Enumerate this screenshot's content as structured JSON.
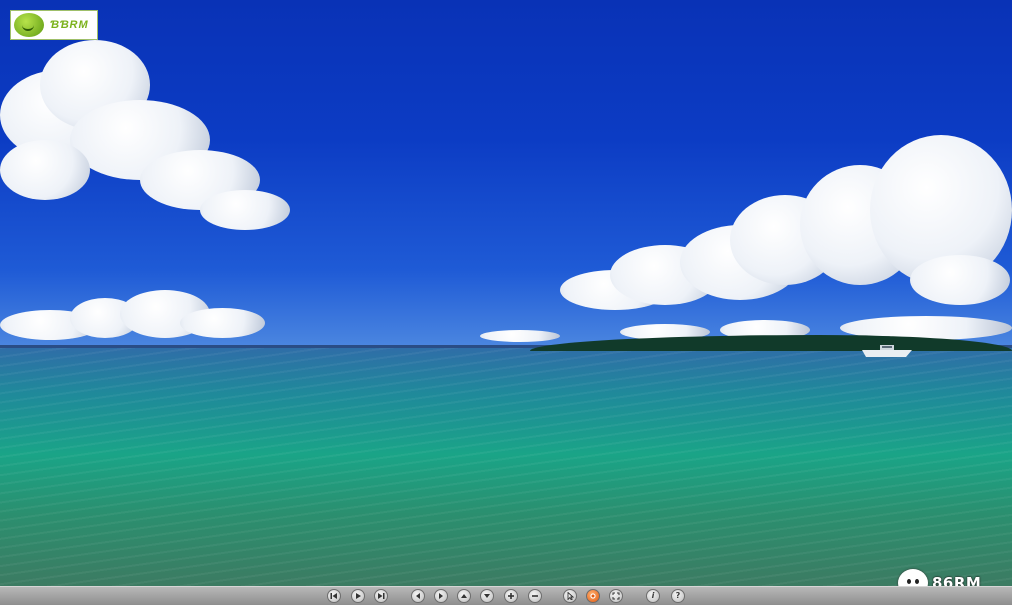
{
  "logo": {
    "text": "ƁƁRM",
    "icon": "smiley-ball-icon",
    "accent": "#7bb21c"
  },
  "brand": {
    "text": "86RM",
    "icon": "face-icon"
  },
  "toolbar": {
    "buttons": [
      {
        "name": "skip-back-button",
        "icon": "skip-back-icon"
      },
      {
        "name": "play-button",
        "icon": "play-icon"
      },
      {
        "name": "skip-forward-button",
        "icon": "skip-forward-icon"
      },
      {
        "name": "pan-left-button",
        "icon": "arrow-left-icon"
      },
      {
        "name": "pan-right-button",
        "icon": "arrow-right-icon"
      },
      {
        "name": "pan-up-button",
        "icon": "arrow-up-icon"
      },
      {
        "name": "pan-down-button",
        "icon": "arrow-down-icon"
      },
      {
        "name": "zoom-in-button",
        "icon": "plus-icon"
      },
      {
        "name": "zoom-out-button",
        "icon": "minus-icon"
      },
      {
        "name": "cursor-mode-button",
        "icon": "cursor-icon"
      },
      {
        "name": "autorotate-button",
        "icon": "record-icon",
        "active": true
      },
      {
        "name": "fullscreen-button",
        "icon": "fullscreen-icon"
      },
      {
        "name": "info-button",
        "icon": "info-icon",
        "label": "i"
      },
      {
        "name": "help-button",
        "icon": "help-icon",
        "label": "?"
      }
    ]
  },
  "colors": {
    "sky": "#0c3cc4",
    "toolbar": "#a6a6a6",
    "active_button": "#e25a10"
  }
}
